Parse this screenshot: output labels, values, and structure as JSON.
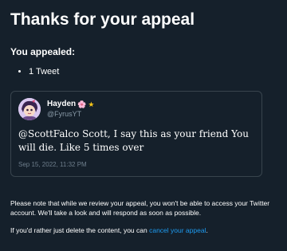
{
  "page": {
    "title": "Thanks for your appeal",
    "subhead": "You appealed:",
    "items": [
      "1 Tweet"
    ]
  },
  "tweet": {
    "display_name": "Hayden",
    "badge_emoji_1": "🌸",
    "badge_emoji_2": "★",
    "handle": "@FyrusYT",
    "text": "@ScottFalco Scott, I say this as your friend You will die. Like 5 times over",
    "timestamp": "Sep 15, 2022, 11:32 PM"
  },
  "notes": {
    "review_notice": "Please note that while we review your appeal, you won't be able to access your Twitter account. We'll take a look and will respond as soon as possible.",
    "delete_prefix": "If you'd rather just delete the content, you can ",
    "cancel_link": "cancel your appeal",
    "delete_suffix": "."
  },
  "colors": {
    "background": "#15202b",
    "link": "#1d9bf0",
    "muted": "#8899a6",
    "border": "#38444d"
  }
}
